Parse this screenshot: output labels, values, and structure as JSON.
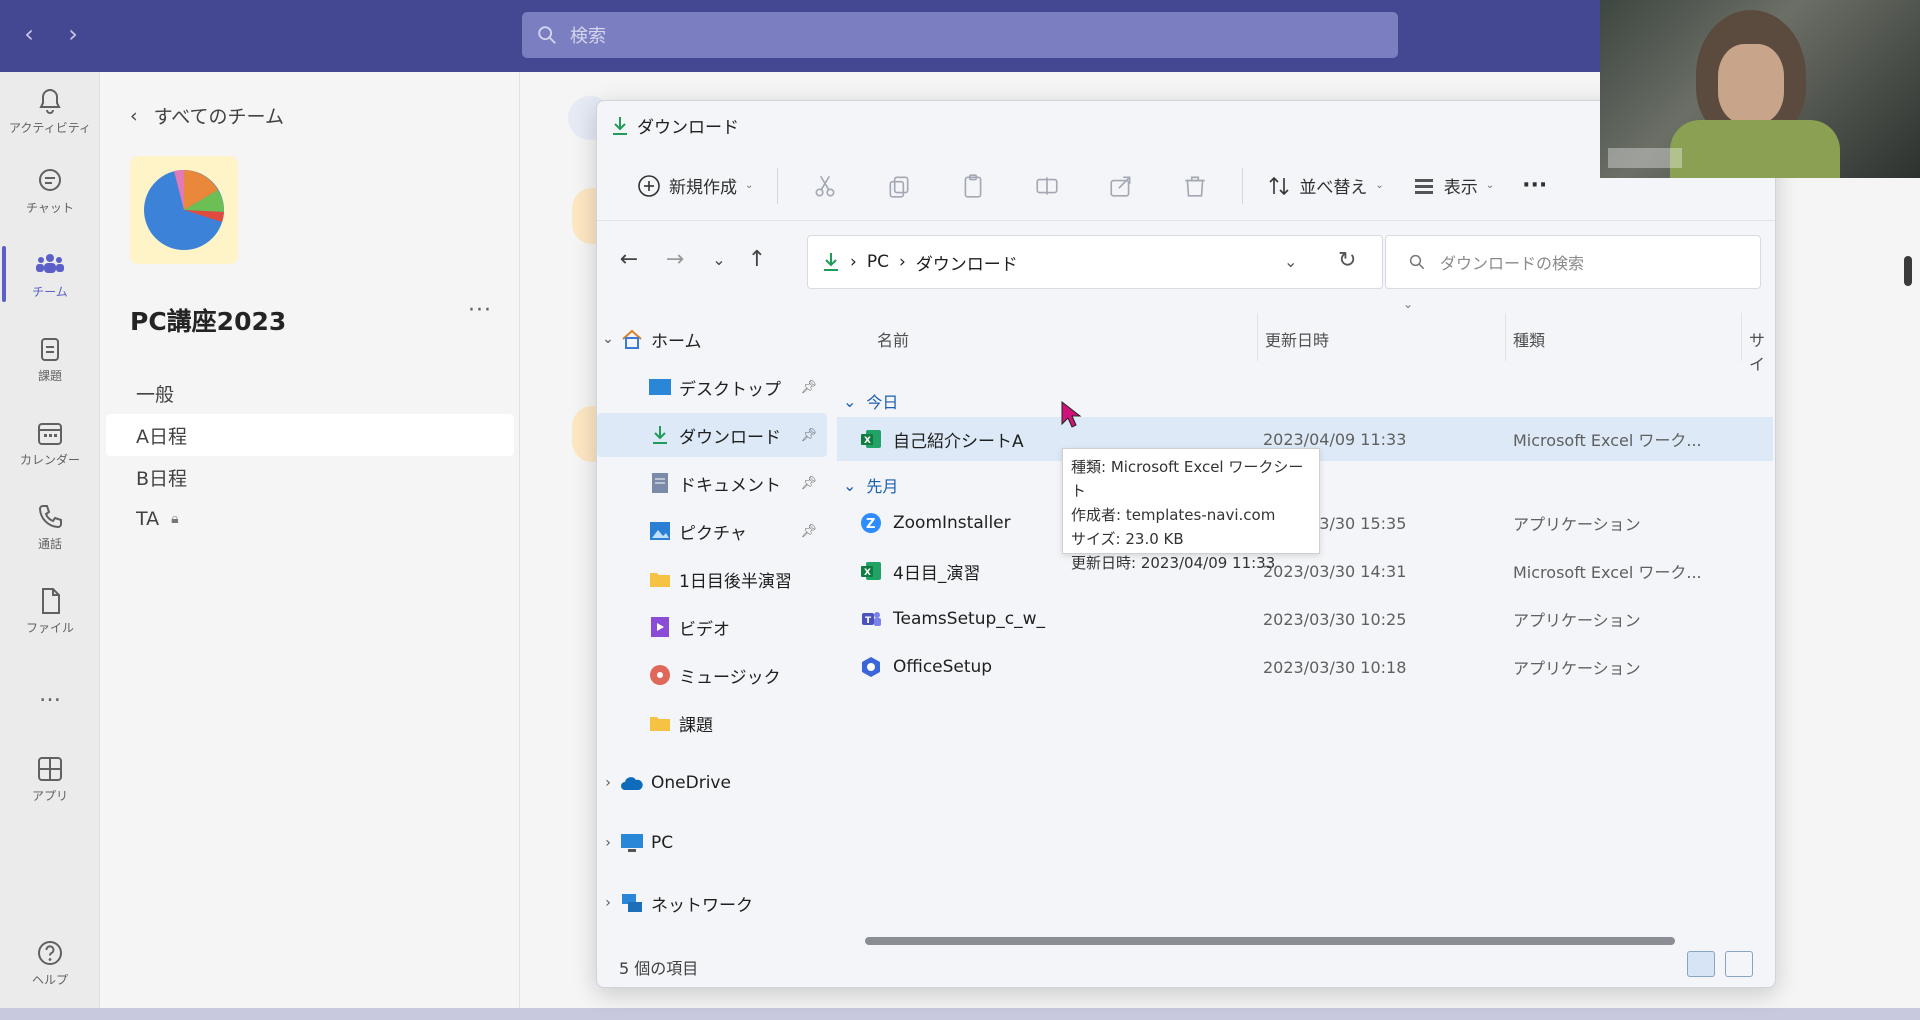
{
  "search": {
    "placeholder": "検索"
  },
  "rail": {
    "items": [
      {
        "label": "アクティビティ",
        "icon": "bell-icon"
      },
      {
        "label": "チャット",
        "icon": "chat-icon"
      },
      {
        "label": "チーム",
        "icon": "teams-icon",
        "active": true
      },
      {
        "label": "課題",
        "icon": "assignments-icon"
      },
      {
        "label": "カレンダー",
        "icon": "calendar-icon"
      },
      {
        "label": "通話",
        "icon": "phone-icon"
      },
      {
        "label": "ファイル",
        "icon": "file-icon"
      },
      {
        "label": "…",
        "icon": "more-icon"
      },
      {
        "label": "アプリ",
        "icon": "apps-icon"
      },
      {
        "label": "ヘルプ",
        "icon": "help-icon"
      }
    ]
  },
  "team": {
    "back_label": "すべてのチーム",
    "name": "PC講座2023",
    "more": "···",
    "channels": [
      {
        "label": "一般"
      },
      {
        "label": "A日程",
        "active": true
      },
      {
        "label": "B日程"
      },
      {
        "label": "TA"
      }
    ]
  },
  "explorer": {
    "title": "ダウンロード",
    "toolbar": {
      "new_label": "新規作成",
      "sort_label": "並べ替え",
      "view_label": "表示",
      "more": "···"
    },
    "breadcrumb": {
      "pc": "PC",
      "sep": "›",
      "folder": "ダウンロード"
    },
    "search_placeholder": "ダウンロードの検索",
    "sidebar": {
      "home": "ホーム",
      "quick": [
        {
          "label": "デスクトップ",
          "pinned": true
        },
        {
          "label": "ダウンロード",
          "pinned": true,
          "selected": true
        },
        {
          "label": "ドキュメント",
          "pinned": true
        },
        {
          "label": "ピクチャ",
          "pinned": true
        },
        {
          "label": "1日目後半演習"
        },
        {
          "label": "ビデオ"
        },
        {
          "label": "ミュージック"
        },
        {
          "label": "課題"
        }
      ],
      "onedrive": "OneDrive",
      "pc": "PC",
      "network": "ネットワーク"
    },
    "columns": {
      "name": "名前",
      "date": "更新日時",
      "type": "種類",
      "size": "サイ"
    },
    "groups": [
      {
        "label": "今日",
        "files": [
          {
            "name": "自己紹介シートA",
            "date": "2023/04/09 11:33",
            "type": "Microsoft Excel ワーク...",
            "icon": "excel-icon",
            "selected": true
          }
        ]
      },
      {
        "label": "先月",
        "files": [
          {
            "name": "ZoomInstaller",
            "date": "2023/03/30 15:35",
            "type": "アプリケーション",
            "icon": "zoom-icon"
          },
          {
            "name": "4日目_演習",
            "date": "2023/03/30 14:31",
            "type": "Microsoft Excel ワーク...",
            "icon": "excel-icon"
          },
          {
            "name": "TeamsSetup_c_w_",
            "date": "2023/03/30 10:25",
            "type": "アプリケーション",
            "icon": "teams-app-icon"
          },
          {
            "name": "OfficeSetup",
            "date": "2023/03/30 10:18",
            "type": "アプリケーション",
            "icon": "office-icon"
          }
        ]
      }
    ],
    "tooltip": {
      "line1": "種類: Microsoft Excel ワークシート",
      "line2": "作成者: templates-navi.com",
      "line3": "サイズ: 23.0 KB",
      "line4": "更新日時: 2023/04/09 11:33"
    },
    "status": "5 個の項目"
  },
  "colors": {
    "teams_purple": "#444791",
    "accent": "#5b5fc7",
    "selection": "#dde9f7",
    "link": "#1c5fb0"
  }
}
